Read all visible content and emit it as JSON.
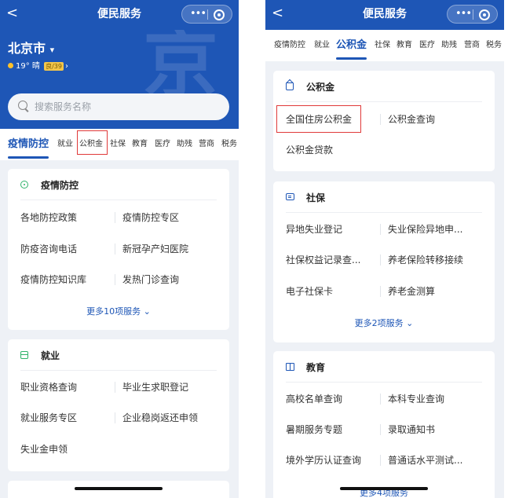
{
  "left": {
    "topbar": {
      "back": "<",
      "title": "便民服务",
      "more": "•••"
    },
    "hero": {
      "city": "北京市",
      "city_arrow": "▾",
      "weather_text": "19° 晴",
      "aqi_badge": "良/39",
      "weather_arrow": "›",
      "deco_glyph": "京"
    },
    "search": {
      "placeholder": "搜索服务名称"
    },
    "tabs": [
      "疫情防控",
      "就业",
      "公积金",
      "社保",
      "教育",
      "医疗",
      "助残",
      "营商",
      "税务"
    ],
    "cards": [
      {
        "icon": "shield-icon",
        "title": "疫情防控",
        "services": [
          "各地防控政策",
          "疫情防控专区",
          "防疫咨询电话",
          "新冠孕产妇医院",
          "疫情防控知识库",
          "发热门诊查询"
        ],
        "more": "更多10项服务 ⌄"
      },
      {
        "icon": "briefcase-icon",
        "title": "就业",
        "services": [
          "职业资格查询",
          "毕业生求职登记",
          "就业服务专区",
          "企业稳岗返还申领",
          "失业金申领"
        ]
      }
    ]
  },
  "right": {
    "topbar": {
      "back": "<",
      "title": "便民服务",
      "more": "•••"
    },
    "tabs": [
      "疫情防控",
      "就业",
      "公积金",
      "社保",
      "教育",
      "医疗",
      "助残",
      "营商",
      "税务"
    ],
    "cards": [
      {
        "icon": "house-icon",
        "title": "公积金",
        "services": [
          "全国住房公积金",
          "公积金查询",
          "公积金贷款"
        ]
      },
      {
        "icon": "id-card-icon",
        "title": "社保",
        "services": [
          "异地失业登记",
          "失业保险异地申...",
          "社保权益记录查...",
          "养老保险转移接续",
          "电子社保卡",
          "养老金测算"
        ],
        "more": "更多2项服务 ⌄"
      },
      {
        "icon": "book-icon",
        "title": "教育",
        "services": [
          "高校名单查询",
          "本科专业查询",
          "暑期服务专题",
          "录取通知书",
          "境外学历认证查询",
          "普通话水平测试..."
        ],
        "more": "更多4项服务"
      }
    ]
  },
  "colors": {
    "primary": "#1e56b6",
    "highlight": "#e03a3a",
    "icon_green": "#2fb36a",
    "background": "#eef1f6"
  }
}
